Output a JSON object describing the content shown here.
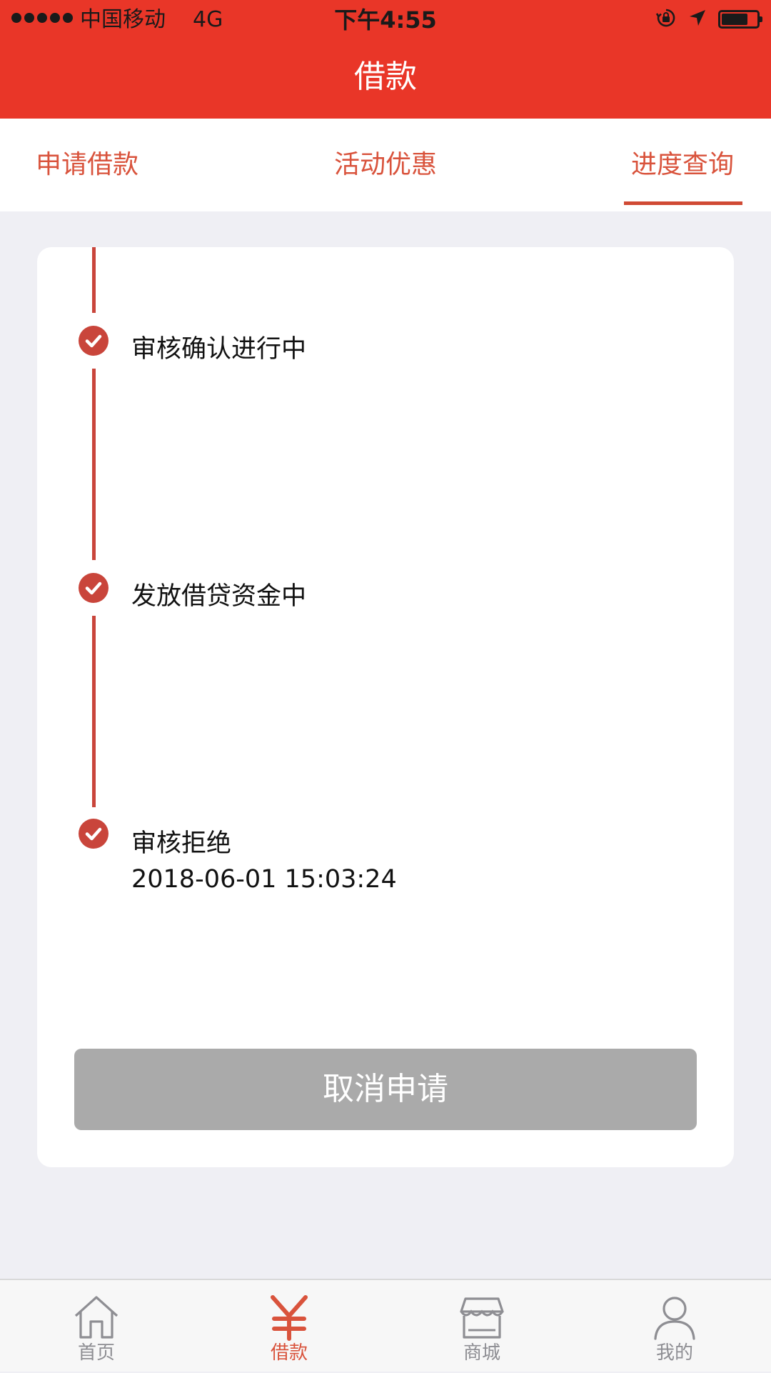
{
  "status_bar": {
    "carrier": "中国移动",
    "network": "4G",
    "time": "下午4:55"
  },
  "nav": {
    "title": "借款"
  },
  "tabs": [
    {
      "label": "申请借款",
      "active": false
    },
    {
      "label": "活动优惠",
      "active": false
    },
    {
      "label": "进度查询",
      "active": true
    }
  ],
  "timeline": [
    {
      "title": "审核确认进行中",
      "time": ""
    },
    {
      "title": "发放借贷资金中",
      "time": ""
    },
    {
      "title": "审核拒绝",
      "time": "2018-06-01 15:03:24"
    }
  ],
  "cancel_button": {
    "label": "取消申请"
  },
  "tabbar": [
    {
      "label": "首页",
      "icon": "home-icon",
      "active": false
    },
    {
      "label": "借款",
      "icon": "yen-icon",
      "active": true
    },
    {
      "label": "商城",
      "icon": "shop-icon",
      "active": false
    },
    {
      "label": "我的",
      "icon": "user-icon",
      "active": false
    }
  ],
  "colors": {
    "header_red": "#E93628",
    "accent": "#D9533C",
    "timeline": "#C9453B",
    "disabled_button": "#AAAAAA",
    "background": "#EFEFF4"
  }
}
